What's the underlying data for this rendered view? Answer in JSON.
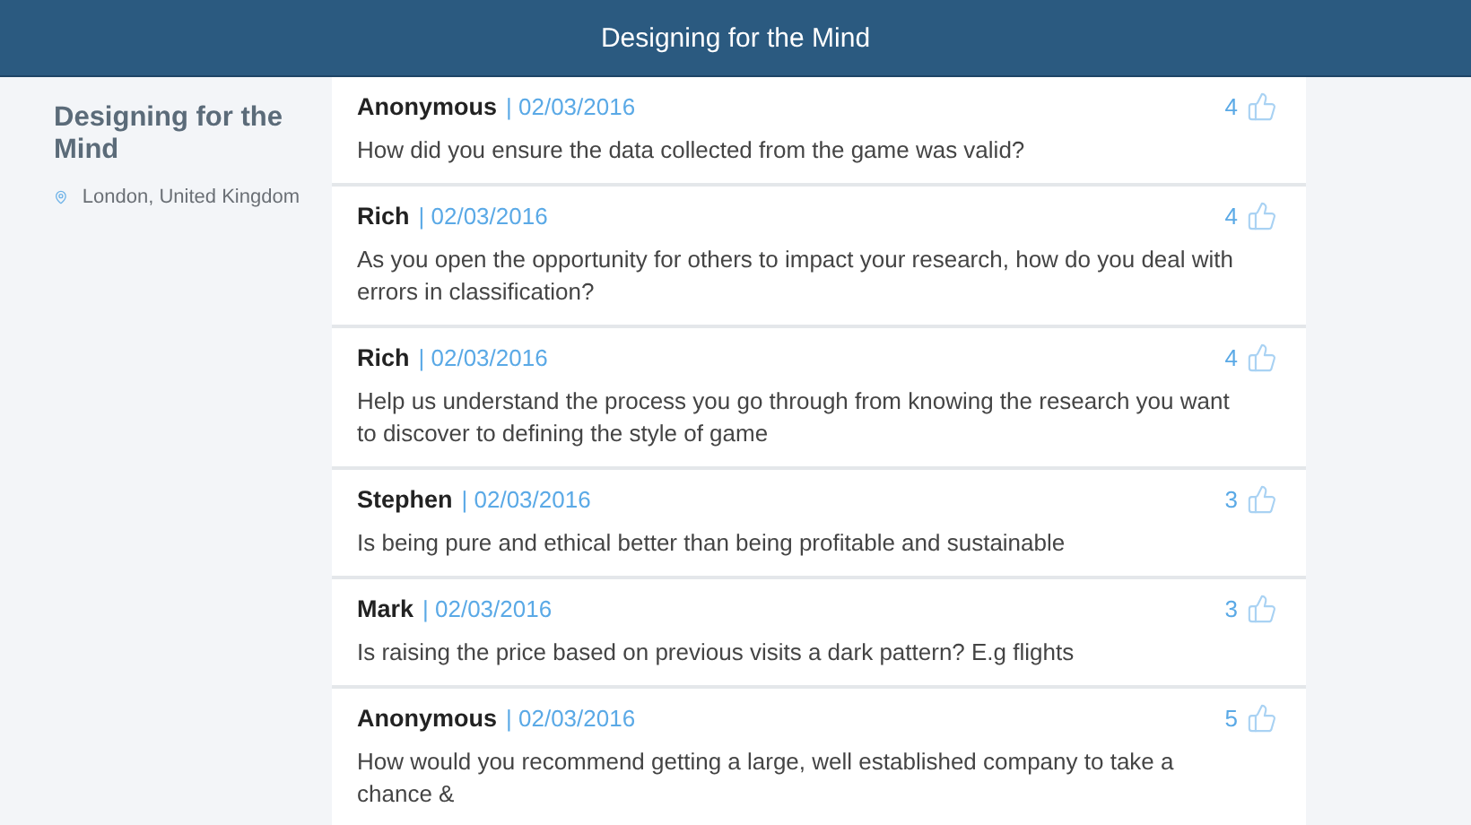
{
  "header": {
    "title": "Designing for the Mind"
  },
  "event": {
    "title": "Designing for the Mind",
    "location": "London, United Kingdom"
  },
  "questions": [
    {
      "author": "Anonymous",
      "date": "| 02/03/2016",
      "votes": "4",
      "text": "How did you ensure the data collected from the game was valid?"
    },
    {
      "author": "Rich",
      "date": "| 02/03/2016",
      "votes": "4",
      "text": "As you open the opportunity for others to impact your research, how do you deal with errors in classification?"
    },
    {
      "author": "Rich",
      "date": "| 02/03/2016",
      "votes": "4",
      "text": "Help us understand the process you go through from knowing the research you want to discover to defining the style of game"
    },
    {
      "author": "Stephen",
      "date": "| 02/03/2016",
      "votes": "3",
      "text": "Is being pure and ethical better than being profitable and sustainable"
    },
    {
      "author": "Mark",
      "date": "| 02/03/2016",
      "votes": "3",
      "text": "Is raising the price based on previous visits a dark pattern? E.g flights"
    },
    {
      "author": "Anonymous",
      "date": "| 02/03/2016",
      "votes": "5",
      "text": "How would you recommend getting a large, well established company to take a chance &"
    }
  ]
}
